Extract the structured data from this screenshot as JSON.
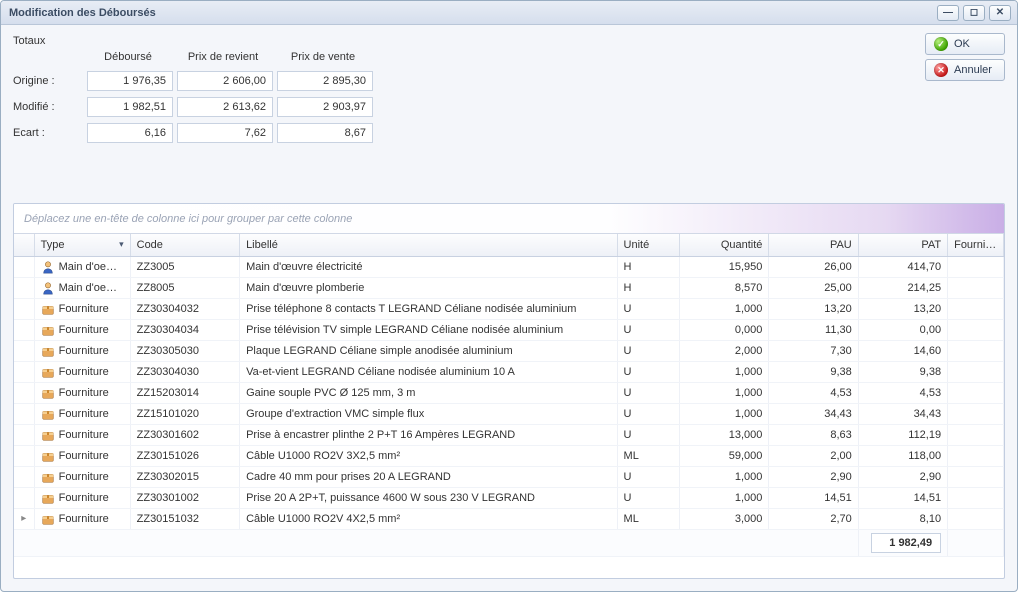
{
  "window": {
    "title": "Modification des Déboursés"
  },
  "actions": {
    "ok": "OK",
    "cancel": "Annuler"
  },
  "totals": {
    "section": "Totaux",
    "headers": {
      "debourse": "Déboursé",
      "prix_revient": "Prix de revient",
      "prix_vente": "Prix de vente"
    },
    "rows": {
      "origine": {
        "label": "Origine :",
        "debourse": "1 976,35",
        "prix_revient": "2 606,00",
        "prix_vente": "2 895,30"
      },
      "modifie": {
        "label": "Modifié :",
        "debourse": "1 982,51",
        "prix_revient": "2 613,62",
        "prix_vente": "2 903,97"
      },
      "ecart": {
        "label": "Ecart :",
        "debourse": "6,16",
        "prix_revient": "7,62",
        "prix_vente": "8,67"
      }
    }
  },
  "grid": {
    "group_hint": "Déplacez une en-tête de colonne ici pour grouper par cette colonne",
    "headers": {
      "type": "Type",
      "code": "Code",
      "libelle": "Libellé",
      "unite": "Unité",
      "quantite": "Quantité",
      "pau": "PAU",
      "pat": "PAT",
      "fournisseur": "Fournis…"
    },
    "rows": [
      {
        "icon": "labor",
        "type": "Main d'oe…",
        "code": "ZZ3005",
        "libelle": "Main d'œuvre électricité",
        "unite": "H",
        "quantite": "15,950",
        "pau": "26,00",
        "pat": "414,70"
      },
      {
        "icon": "labor",
        "type": "Main d'oe…",
        "code": "ZZ8005",
        "libelle": "Main d'œuvre plomberie",
        "unite": "H",
        "quantite": "8,570",
        "pau": "25,00",
        "pat": "214,25"
      },
      {
        "icon": "supply",
        "type": "Fourniture",
        "code": "ZZ30304032",
        "libelle": "Prise téléphone 8 contacts T LEGRAND Céliane nodisée aluminium",
        "unite": "U",
        "quantite": "1,000",
        "pau": "13,20",
        "pat": "13,20"
      },
      {
        "icon": "supply",
        "type": "Fourniture",
        "code": "ZZ30304034",
        "libelle": "Prise télévision TV simple LEGRAND Céliane nodisée aluminium",
        "unite": "U",
        "quantite": "0,000",
        "pau": "11,30",
        "pat": "0,00"
      },
      {
        "icon": "supply",
        "type": "Fourniture",
        "code": "ZZ30305030",
        "libelle": "Plaque LEGRAND Céliane simple anodisée aluminium",
        "unite": "U",
        "quantite": "2,000",
        "pau": "7,30",
        "pat": "14,60"
      },
      {
        "icon": "supply",
        "type": "Fourniture",
        "code": "ZZ30304030",
        "libelle": "Va-et-vient LEGRAND Céliane nodisée aluminium 10 A",
        "unite": "U",
        "quantite": "1,000",
        "pau": "9,38",
        "pat": "9,38"
      },
      {
        "icon": "supply",
        "type": "Fourniture",
        "code": "ZZ15203014",
        "libelle": "Gaine souple PVC Ø 125 mm, 3 m",
        "unite": "U",
        "quantite": "1,000",
        "pau": "4,53",
        "pat": "4,53"
      },
      {
        "icon": "supply",
        "type": "Fourniture",
        "code": "ZZ15101020",
        "libelle": "Groupe d'extraction VMC simple flux",
        "unite": "U",
        "quantite": "1,000",
        "pau": "34,43",
        "pat": "34,43"
      },
      {
        "icon": "supply",
        "type": "Fourniture",
        "code": "ZZ30301602",
        "libelle": "Prise à encastrer plinthe 2 P+T 16 Ampères LEGRAND",
        "unite": "U",
        "quantite": "13,000",
        "pau": "8,63",
        "pat": "112,19"
      },
      {
        "icon": "supply",
        "type": "Fourniture",
        "code": "ZZ30151026",
        "libelle": "Câble U1000 RO2V 3X2,5 mm²",
        "unite": "ML",
        "quantite": "59,000",
        "pau": "2,00",
        "pat": "118,00"
      },
      {
        "icon": "supply",
        "type": "Fourniture",
        "code": "ZZ30302015",
        "libelle": "Cadre 40 mm pour prises 20 A LEGRAND",
        "unite": "U",
        "quantite": "1,000",
        "pau": "2,90",
        "pat": "2,90"
      },
      {
        "icon": "supply",
        "type": "Fourniture",
        "code": "ZZ30301002",
        "libelle": "Prise 20 A 2P+T, puissance 4600 W sous 230 V LEGRAND",
        "unite": "U",
        "quantite": "1,000",
        "pau": "14,51",
        "pat": "14,51"
      },
      {
        "icon": "supply",
        "type": "Fourniture",
        "code": "ZZ30151032",
        "libelle": "Câble U1000 RO2V 4X2,5 mm²",
        "unite": "ML",
        "quantite": "3,000",
        "pau": "2,70",
        "pat": "8,10",
        "current": true
      }
    ],
    "footer_total": "1 982,49"
  }
}
